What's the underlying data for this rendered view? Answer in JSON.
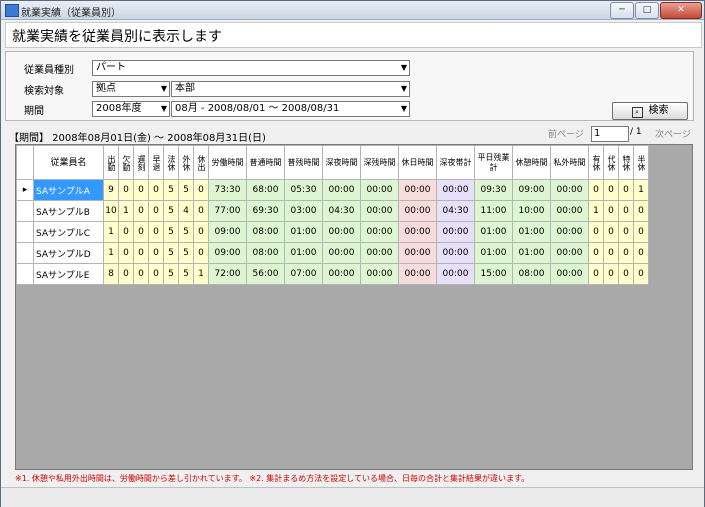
{
  "window": {
    "title": "就業実績（従業員別）",
    "btn_min": "─",
    "btn_max": "□",
    "btn_close": "✕"
  },
  "page_title": "就業実績を従業員別に表示します",
  "filters": {
    "employee_type_label": "従業員種別",
    "employee_type_value": "パート",
    "search_target_label": "検索対象",
    "search_target_type": "拠点",
    "search_target_value": "本部",
    "period_label": "期間",
    "period_year": "2008年度",
    "period_month": "08月 - 2008/08/01 ～ 2008/08/31"
  },
  "search_button": "検索",
  "period_text": "【期間】 2008年08月01日(金) ～ 2008年08月31日(日)",
  "pager": {
    "prev": "前ページ",
    "current": "1",
    "total": "/ 1",
    "next": "次ページ"
  },
  "columns": [
    "従業員名",
    "出勤",
    "欠勤",
    "遅刻",
    "早退",
    "法休",
    "外休",
    "休出",
    "労働時間",
    "普通時間",
    "普残時間",
    "深夜時間",
    "深残時間",
    "休日時間",
    "深夜帯計",
    "平日残業計",
    "休憩時間",
    "私外時間",
    "有休",
    "代休",
    "特休",
    "半休"
  ],
  "rows": [
    {
      "name": "SAサンプルA",
      "cells": [
        "9",
        "0",
        "0",
        "0",
        "5",
        "5",
        "0",
        "73:30",
        "68:00",
        "05:30",
        "00:00",
        "00:00",
        "00:00",
        "00:00",
        "09:30",
        "09:00",
        "00:00",
        "0",
        "0",
        "0",
        "1"
      ]
    },
    {
      "name": "SAサンプルB",
      "cells": [
        "10",
        "1",
        "0",
        "0",
        "5",
        "4",
        "0",
        "77:00",
        "69:30",
        "03:00",
        "04:30",
        "00:00",
        "00:00",
        "04:30",
        "11:00",
        "10:00",
        "00:00",
        "1",
        "0",
        "0",
        "0"
      ]
    },
    {
      "name": "SAサンプルC",
      "cells": [
        "1",
        "0",
        "0",
        "0",
        "5",
        "5",
        "0",
        "09:00",
        "08:00",
        "01:00",
        "00:00",
        "00:00",
        "00:00",
        "00:00",
        "01:00",
        "01:00",
        "00:00",
        "0",
        "0",
        "0",
        "0"
      ]
    },
    {
      "name": "SAサンプルD",
      "cells": [
        "1",
        "0",
        "0",
        "0",
        "5",
        "5",
        "0",
        "09:00",
        "08:00",
        "01:00",
        "00:00",
        "00:00",
        "00:00",
        "00:00",
        "01:00",
        "01:00",
        "00:00",
        "0",
        "0",
        "0",
        "0"
      ]
    },
    {
      "name": "SAサンプルE",
      "cells": [
        "8",
        "0",
        "0",
        "0",
        "5",
        "5",
        "1",
        "72:00",
        "56:00",
        "07:00",
        "00:00",
        "00:00",
        "00:00",
        "00:00",
        "15:00",
        "08:00",
        "00:00",
        "0",
        "0",
        "0",
        "0"
      ]
    }
  ],
  "note": "※1. 休憩や私用外出時間は、労働時間から差し引かれています。 ※2. 集計まるめ方法を設定している場合、日毎の合計と集計結果が違います。",
  "colors": {
    "yellow": "#ffffcc",
    "green": "#ddf5d0",
    "pink": "#f8dcdc",
    "lavender": "#e6e0f8",
    "selected": "#3399ff"
  }
}
